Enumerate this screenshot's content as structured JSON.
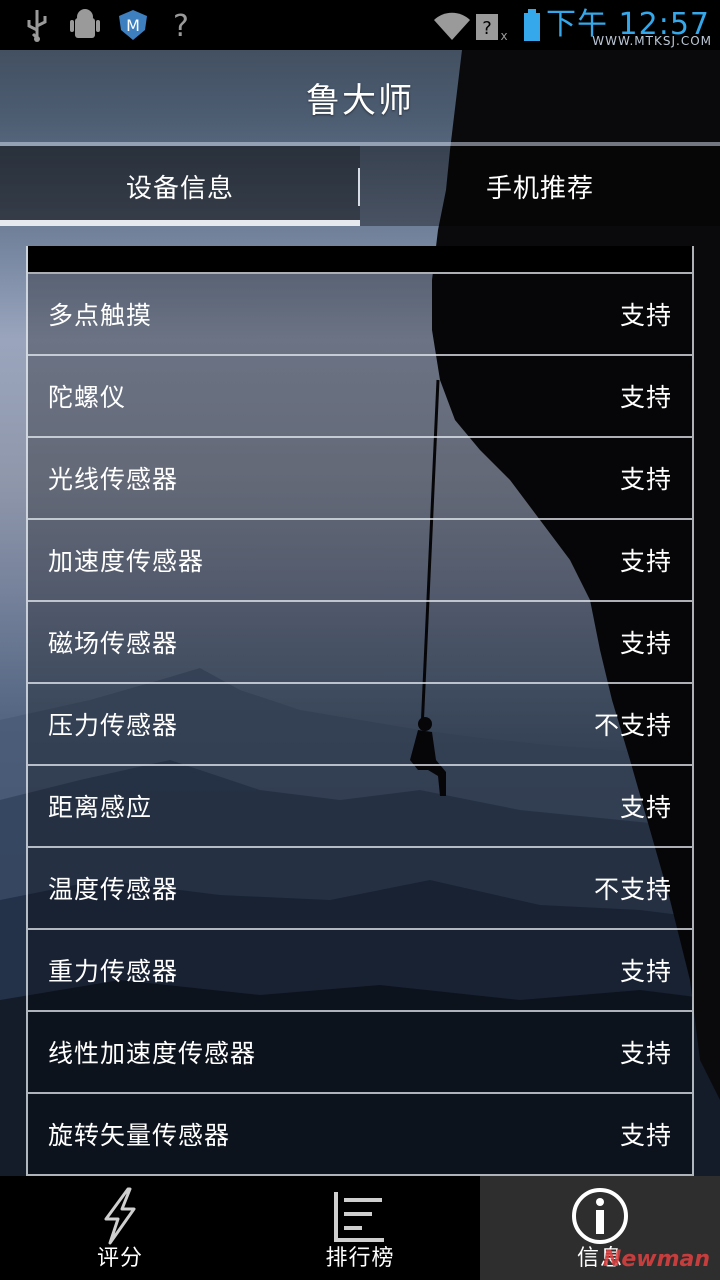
{
  "status_bar": {
    "time": "下午 12:57",
    "watermark": "WWW.MTKSJ.COM",
    "icons": [
      "usb-icon",
      "android-debug-icon",
      "security-app-icon",
      "no-sim-icon",
      "wifi-icon",
      "mobile-signal-icon",
      "battery-icon"
    ]
  },
  "header": {
    "title": "鲁大师"
  },
  "tabs": [
    {
      "label": "设备信息",
      "active": true
    },
    {
      "label": "手机推荐",
      "active": false
    }
  ],
  "features": [
    {
      "name": "多点触摸",
      "value": "支持"
    },
    {
      "name": "陀螺仪",
      "value": "支持"
    },
    {
      "name": "光线传感器",
      "value": "支持"
    },
    {
      "name": "加速度传感器",
      "value": "支持"
    },
    {
      "name": "磁场传感器",
      "value": "支持"
    },
    {
      "name": "压力传感器",
      "value": "不支持"
    },
    {
      "name": "距离感应",
      "value": "支持"
    },
    {
      "name": "温度传感器",
      "value": "不支持"
    },
    {
      "name": "重力传感器",
      "value": "支持"
    },
    {
      "name": "线性加速度传感器",
      "value": "支持"
    },
    {
      "name": "旋转矢量传感器",
      "value": "支持"
    }
  ],
  "bottom_nav": [
    {
      "label": "评分",
      "icon": "lightning-icon",
      "active": false
    },
    {
      "label": "排行榜",
      "icon": "ranking-list-icon",
      "active": false
    },
    {
      "label": "信息",
      "icon": "info-icon",
      "active": true
    }
  ],
  "corner_mark": "Newman",
  "colors": {
    "status_accent": "#34a8ea",
    "nav_active_bg": "#2e2e2e",
    "text": "#ffffff"
  }
}
